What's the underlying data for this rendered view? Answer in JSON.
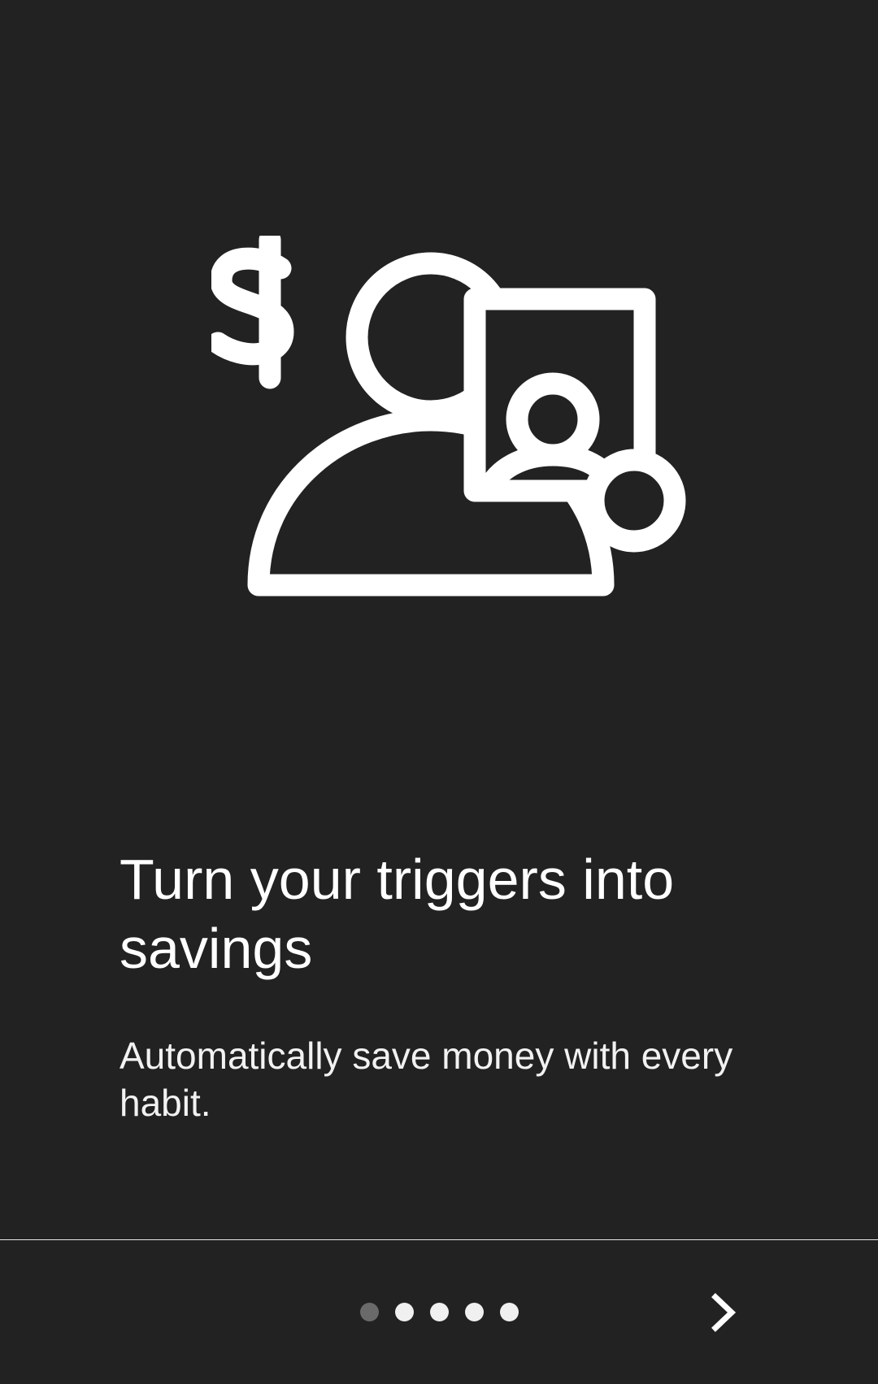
{
  "onboarding": {
    "title": "Turn your triggers into savings",
    "subtitle": "Automatically save money with every habit.",
    "illustration_icon": "person-dollar-card-icon"
  },
  "pager": {
    "total_pages": 5,
    "current_page": 1
  },
  "navigation": {
    "next_icon": "chevron-right-icon"
  },
  "colors": {
    "background": "#222222",
    "foreground": "#ffffff",
    "dot_active": "#6a6a6a",
    "dot_inactive": "#f0f0f0"
  }
}
